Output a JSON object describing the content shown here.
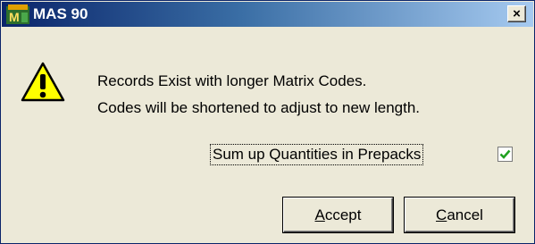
{
  "window": {
    "title": "MAS 90",
    "close_glyph": "×"
  },
  "message": {
    "line1": "Records Exist with longer Matrix Codes.",
    "line2": "Codes will be shortened to adjust to new length.",
    "icon": "warning-icon"
  },
  "option": {
    "label": "Sum up Quantities in Prepacks",
    "checked": true
  },
  "buttons": {
    "accept_label": "Accept",
    "cancel_label": "Cancel"
  },
  "colors": {
    "titlebar_start": "#0a246a",
    "titlebar_end": "#a6caf0",
    "dialog_bg": "#ece9d8",
    "warning_fill": "#ffff00",
    "check_green": "#21a121"
  }
}
